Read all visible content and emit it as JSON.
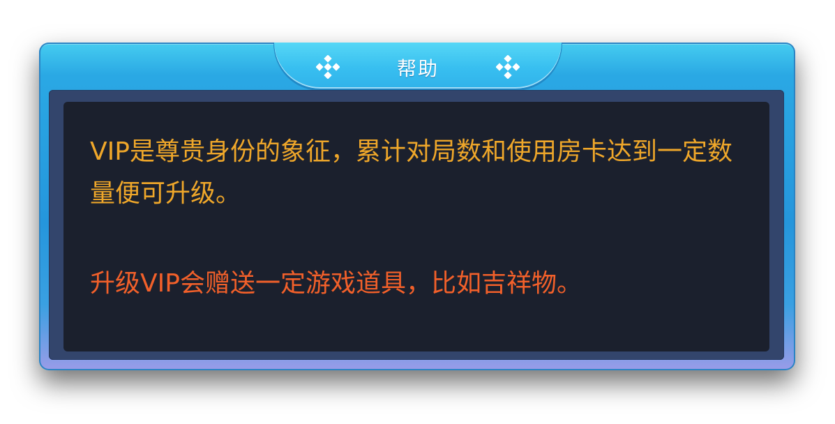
{
  "dialog": {
    "title": "帮助",
    "content": {
      "paragraph_1": "VIP是尊贵身份的象征，累计对局数和使用房卡达到一定数量便可升级。",
      "paragraph_2": "升级VIP会赠送一定游戏道具，比如吉祥物。"
    }
  },
  "colors": {
    "frame_blue": "#2596dc",
    "tab_blue": "#38bff0",
    "content_background": "#1b202d",
    "paragraph_1_text": "#efa72a",
    "paragraph_2_text": "#f2602a",
    "title_text": "#ffffff"
  },
  "icons": {
    "title_left": "diamond-ornament-icon",
    "title_right": "diamond-ornament-icon"
  }
}
